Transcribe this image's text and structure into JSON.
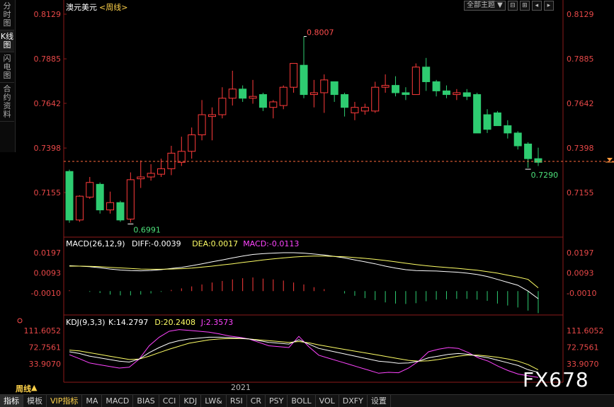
{
  "sidebar": {
    "tabs": [
      {
        "label": "分时图"
      },
      {
        "label": "K线图"
      },
      {
        "label": "闪电图"
      },
      {
        "label": "合约资料"
      }
    ]
  },
  "toolbar": {
    "main_index": "全部主题"
  },
  "bottom": {
    "period": "周线",
    "tabs": [
      "指标",
      "模板",
      "VIP指标",
      "MA",
      "MACD",
      "BIAS",
      "CCI",
      "KDJ",
      "LW&",
      "RSI",
      "CR",
      "PSY",
      "BOLL",
      "VOL",
      "DXFY",
      "设置"
    ]
  },
  "watermark": "FX678",
  "chart_data": [
    {
      "type": "candlestick",
      "title": "澳元美元",
      "subtitle": "<周线>",
      "x_label_year": "2021",
      "yticks": [
        "0.8129",
        "0.7885",
        "0.7642",
        "0.7398",
        "0.7155"
      ],
      "ylim": [
        0.6925,
        0.8129
      ],
      "annotations": {
        "high": "0.8007",
        "low": "0.6991",
        "recent_low": "0.7290"
      },
      "last_price": 0.7325,
      "ohlc": [
        [
          0.727,
          0.728,
          0.699,
          0.7005,
          "down"
        ],
        [
          0.7005,
          0.714,
          0.6995,
          0.7135,
          "up"
        ],
        [
          0.713,
          0.724,
          0.712,
          0.721,
          "up"
        ],
        [
          0.72,
          0.721,
          0.704,
          0.706,
          "down"
        ],
        [
          0.706,
          0.716,
          0.704,
          0.71,
          "up"
        ],
        [
          0.71,
          0.711,
          0.6995,
          0.7005,
          "down"
        ],
        [
          0.701,
          0.7265,
          0.6991,
          0.7225,
          "up"
        ],
        [
          0.723,
          0.733,
          0.718,
          0.724,
          "up"
        ],
        [
          0.724,
          0.731,
          0.722,
          0.726,
          "up"
        ],
        [
          0.7255,
          0.734,
          0.724,
          0.7285,
          "up"
        ],
        [
          0.7285,
          0.741,
          0.725,
          0.737,
          "up"
        ],
        [
          0.732,
          0.746,
          0.73,
          0.738,
          "up"
        ],
        [
          0.738,
          0.751,
          0.734,
          0.747,
          "up"
        ],
        [
          0.747,
          0.766,
          0.744,
          0.758,
          "up"
        ],
        [
          0.757,
          0.762,
          0.744,
          0.758,
          "up"
        ],
        [
          0.758,
          0.773,
          0.756,
          0.767,
          "up"
        ],
        [
          0.767,
          0.782,
          0.763,
          0.772,
          "up"
        ],
        [
          0.772,
          0.774,
          0.765,
          0.767,
          "down"
        ],
        [
          0.767,
          0.777,
          0.764,
          0.768,
          "up"
        ],
        [
          0.769,
          0.77,
          0.76,
          0.762,
          "down"
        ],
        [
          0.762,
          0.766,
          0.756,
          0.765,
          "up"
        ],
        [
          0.763,
          0.774,
          0.761,
          0.773,
          "up"
        ],
        [
          0.773,
          0.786,
          0.77,
          0.786,
          "up"
        ],
        [
          0.785,
          0.8007,
          0.767,
          0.769,
          "down"
        ],
        [
          0.769,
          0.777,
          0.762,
          0.77,
          "up"
        ],
        [
          0.77,
          0.78,
          0.759,
          0.777,
          "up"
        ],
        [
          0.776,
          0.776,
          0.765,
          0.769,
          "down"
        ],
        [
          0.769,
          0.77,
          0.757,
          0.762,
          "down"
        ],
        [
          0.762,
          0.765,
          0.755,
          0.759,
          "up"
        ],
        [
          0.762,
          0.764,
          0.758,
          0.76,
          "up"
        ],
        [
          0.76,
          0.776,
          0.759,
          0.773,
          "up"
        ],
        [
          0.773,
          0.78,
          0.77,
          0.774,
          "up"
        ],
        [
          0.774,
          0.779,
          0.768,
          0.77,
          "down"
        ],
        [
          0.77,
          0.773,
          0.766,
          0.769,
          "down"
        ],
        [
          0.769,
          0.786,
          0.769,
          0.784,
          "up"
        ],
        [
          0.784,
          0.789,
          0.771,
          0.776,
          "down"
        ],
        [
          0.776,
          0.777,
          0.768,
          0.771,
          "down"
        ],
        [
          0.771,
          0.774,
          0.767,
          0.769,
          "down"
        ],
        [
          0.769,
          0.772,
          0.766,
          0.77,
          "up"
        ],
        [
          0.77,
          0.772,
          0.766,
          0.768,
          "down"
        ],
        [
          0.769,
          0.77,
          0.75,
          0.748,
          "down"
        ],
        [
          0.758,
          0.761,
          0.748,
          0.75,
          "down"
        ],
        [
          0.759,
          0.76,
          0.752,
          0.752,
          "down"
        ],
        [
          0.752,
          0.755,
          0.745,
          0.748,
          "down"
        ],
        [
          0.748,
          0.749,
          0.739,
          0.741,
          "down"
        ],
        [
          0.742,
          0.743,
          0.729,
          0.734,
          "down"
        ],
        [
          0.734,
          0.74,
          0.73,
          0.732,
          "down"
        ]
      ]
    },
    {
      "type": "line",
      "title": "MACD(26,12,9)",
      "legend": [
        {
          "name": "DIFF",
          "value": "-0.0039",
          "color": "#ffffff"
        },
        {
          "name": "DEA",
          "value": "0.0017",
          "color": "#ffff66"
        },
        {
          "name": "MACD",
          "value": "-0.0113",
          "color": "#ff44ff"
        }
      ],
      "yticks": [
        "0.0197",
        "0.0093",
        "-0.0010"
      ],
      "ylim": [
        -0.0105,
        0.0232
      ],
      "diff": [
        0.013,
        0.0128,
        0.0125,
        0.012,
        0.0113,
        0.0108,
        0.0105,
        0.0104,
        0.0106,
        0.011,
        0.0116,
        0.0122,
        0.013,
        0.014,
        0.015,
        0.016,
        0.017,
        0.018,
        0.0188,
        0.0192,
        0.0195,
        0.0197,
        0.0197,
        0.0195,
        0.019,
        0.0185,
        0.0178,
        0.017,
        0.016,
        0.015,
        0.014,
        0.0128,
        0.0118,
        0.011,
        0.0105,
        0.0104,
        0.0103,
        0.01,
        0.0097,
        0.0092,
        0.0085,
        0.0075,
        0.006,
        0.0045,
        0.003,
        0.0,
        -0.0039
      ],
      "dea": [
        0.0128,
        0.0128,
        0.0127,
        0.0125,
        0.0122,
        0.0119,
        0.0116,
        0.0113,
        0.0112,
        0.0112,
        0.0113,
        0.0115,
        0.0118,
        0.0123,
        0.0128,
        0.0134,
        0.014,
        0.0147,
        0.0153,
        0.016,
        0.0165,
        0.017,
        0.0175,
        0.0178,
        0.018,
        0.018,
        0.0178,
        0.0176,
        0.0172,
        0.0168,
        0.0163,
        0.0157,
        0.015,
        0.0143,
        0.0136,
        0.013,
        0.0125,
        0.0121,
        0.0117,
        0.0112,
        0.0107,
        0.01,
        0.0092,
        0.0082,
        0.0072,
        0.006,
        0.0017
      ],
      "macd": [
        0.0004,
        0.0,
        -0.0004,
        -0.001,
        -0.0018,
        -0.0022,
        -0.0022,
        -0.0018,
        -0.0012,
        -0.0004,
        0.0006,
        0.0014,
        0.0024,
        0.0034,
        0.0044,
        0.0052,
        0.006,
        0.0066,
        0.007,
        0.0064,
        0.006,
        0.0054,
        0.0044,
        0.0034,
        0.002,
        0.001,
        0.0,
        -0.0012,
        -0.0024,
        -0.0036,
        -0.0046,
        -0.0058,
        -0.0064,
        -0.0066,
        -0.0062,
        -0.0052,
        -0.0044,
        -0.0042,
        -0.004,
        -0.004,
        -0.0044,
        -0.005,
        -0.0064,
        -0.0074,
        -0.0084,
        -0.01,
        -0.0113
      ]
    },
    {
      "type": "line",
      "title": "KDJ(9,3,3)",
      "legend": [
        {
          "name": "K",
          "value": "14.2797",
          "color": "#ffffff"
        },
        {
          "name": "D",
          "value": "20.2408",
          "color": "#ffff66"
        },
        {
          "name": "J",
          "value": "2.3573",
          "color": "#ff44ff"
        }
      ],
      "yticks": [
        "111.6052",
        "72.7561",
        "33.9070"
      ],
      "ylim": [
        0,
        125
      ],
      "k": [
        62,
        58,
        52,
        48,
        44,
        40,
        38,
        45,
        60,
        72,
        82,
        88,
        92,
        94,
        96,
        96,
        95,
        94,
        92,
        88,
        84,
        82,
        80,
        90,
        80,
        70,
        65,
        60,
        55,
        50,
        45,
        40,
        38,
        35,
        36,
        40,
        48,
        52,
        56,
        58,
        56,
        52,
        48,
        42,
        36,
        30,
        20,
        14
      ],
      "d": [
        66,
        64,
        60,
        56,
        52,
        48,
        44,
        45,
        52,
        60,
        68,
        75,
        82,
        86,
        90,
        92,
        93,
        93,
        92,
        90,
        88,
        86,
        84,
        86,
        83,
        78,
        74,
        70,
        66,
        62,
        58,
        54,
        50,
        46,
        42,
        40,
        41,
        44,
        48,
        52,
        54,
        54,
        52,
        49,
        45,
        40,
        32,
        20
      ],
      "j": [
        55,
        46,
        36,
        32,
        28,
        24,
        26,
        45,
        76,
        96,
        110,
        114,
        112,
        110,
        108,
        104,
        99,
        96,
        92,
        84,
        76,
        74,
        72,
        98,
        74,
        54,
        47,
        40,
        33,
        26,
        19,
        12,
        14,
        13,
        24,
        40,
        62,
        68,
        72,
        70,
        60,
        48,
        40,
        28,
        18,
        10,
        6,
        2
      ]
    }
  ]
}
